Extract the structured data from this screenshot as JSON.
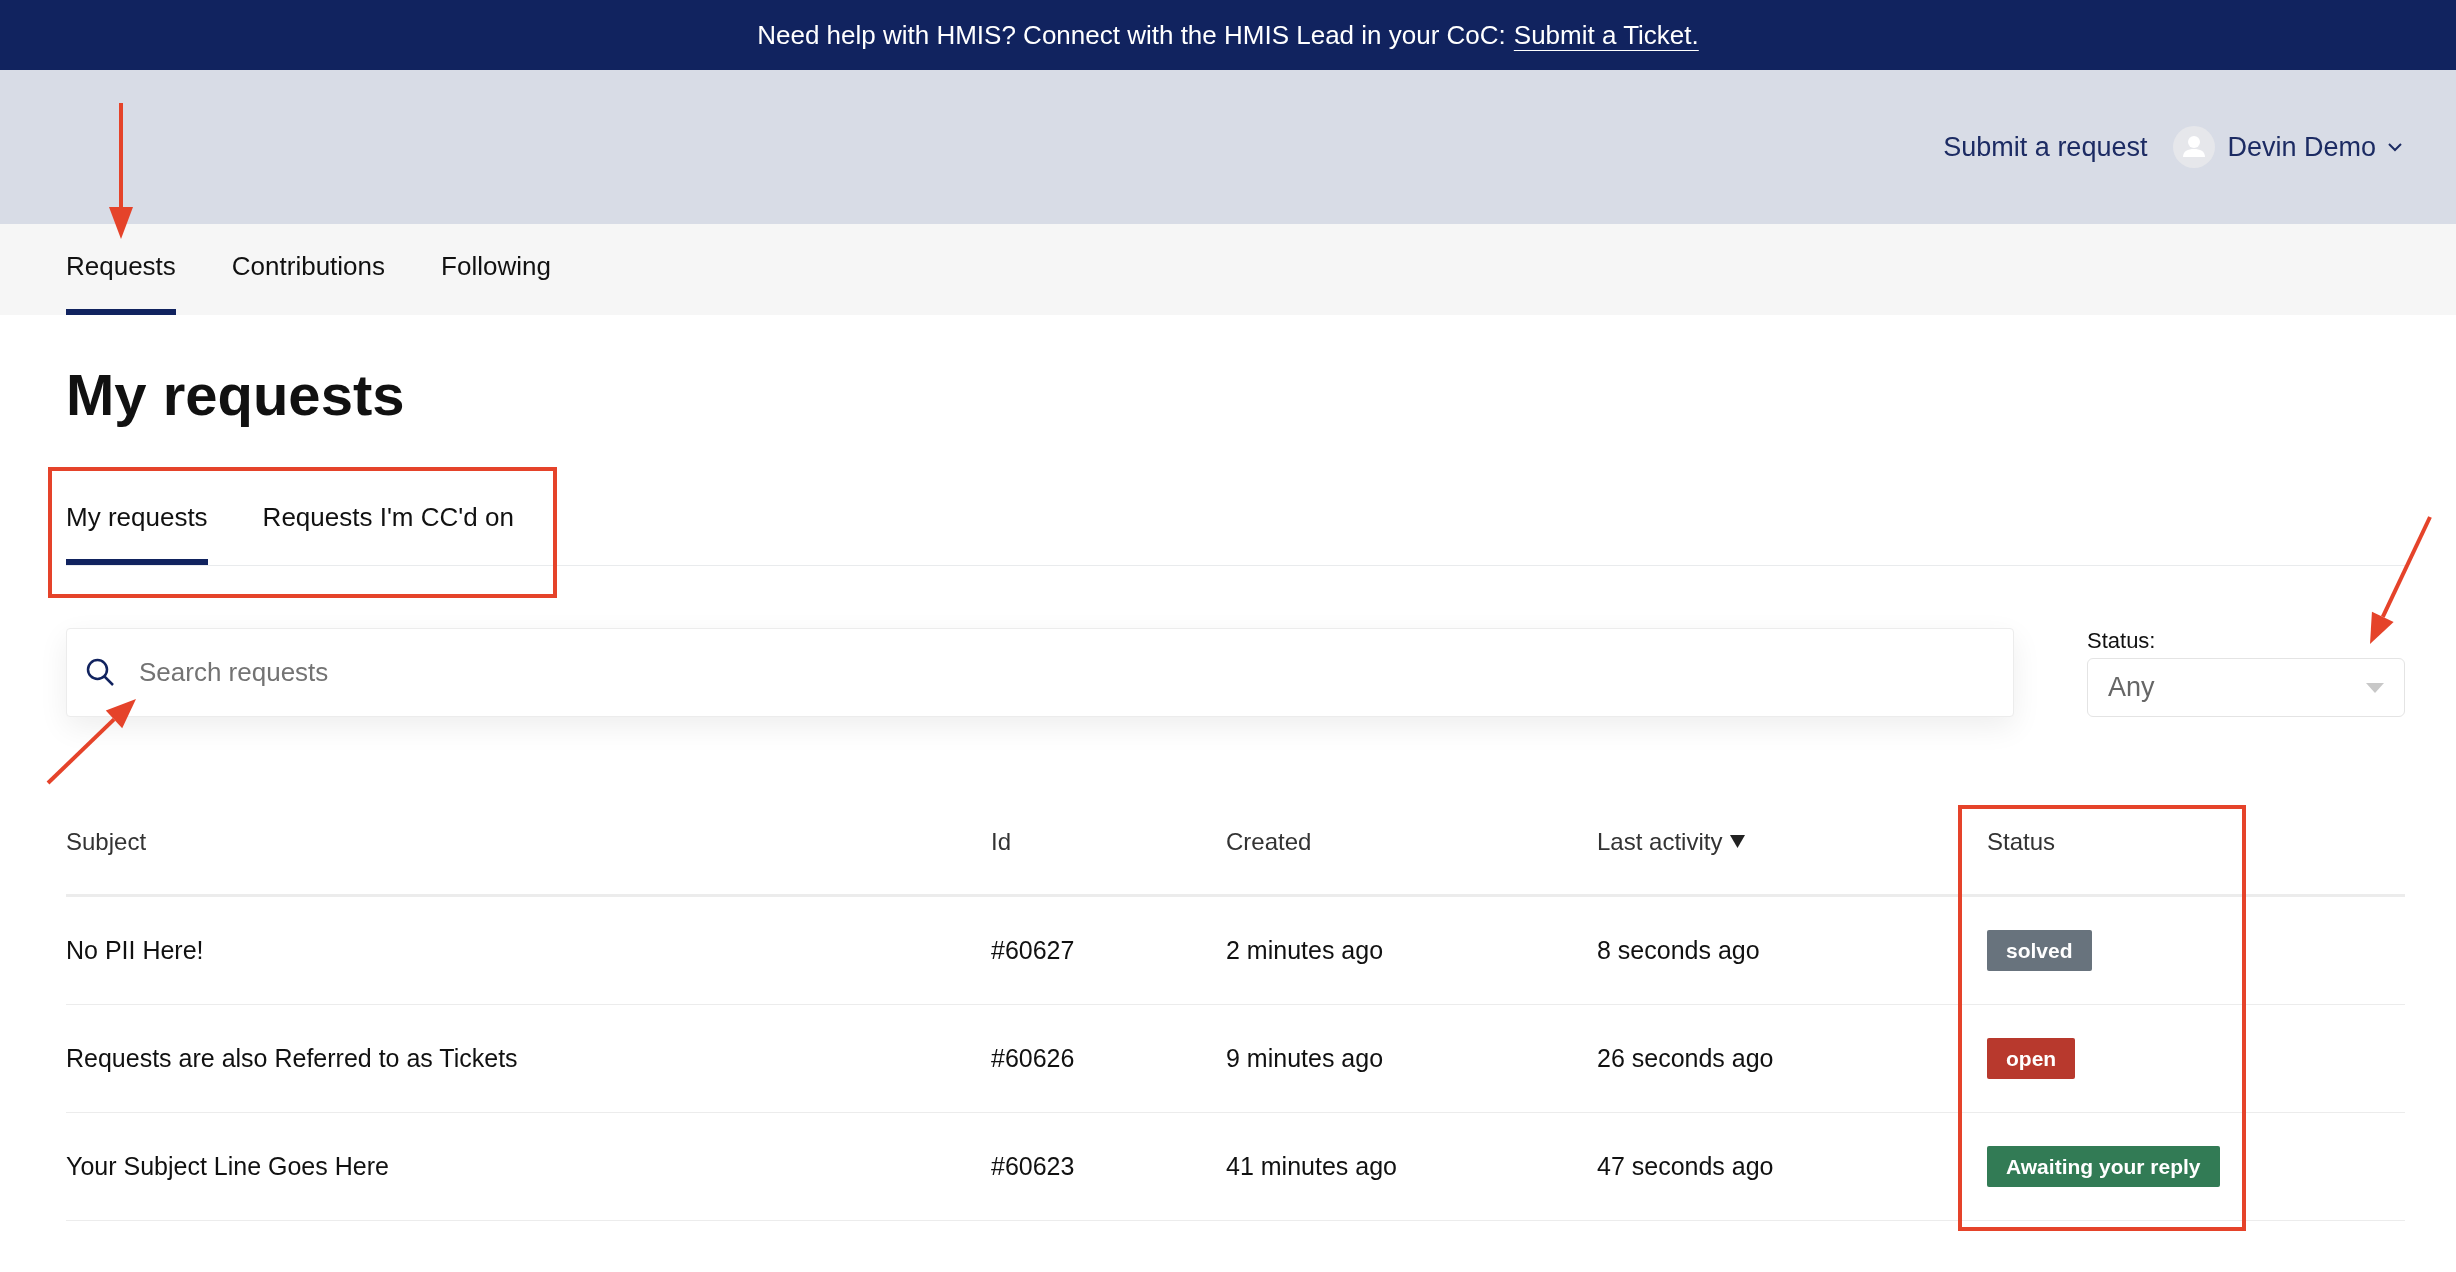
{
  "banner": {
    "text": "Need help with HMIS? Connect with the HMIS Lead in your CoC:",
    "link": "Submit a Ticket."
  },
  "header": {
    "submit_link": "Submit a request",
    "user": {
      "name": "Devin Demo"
    }
  },
  "nav_tabs": [
    {
      "label": "Requests",
      "selected": true,
      "arrow_callout": true
    },
    {
      "label": "Contributions",
      "selected": false,
      "arrow_callout": false
    },
    {
      "label": "Following",
      "selected": false,
      "arrow_callout": false
    }
  ],
  "page_title": "My requests",
  "sub_tabs": {
    "framed": true,
    "items": [
      {
        "label": "My requests",
        "selected": true
      },
      {
        "label": "Requests I'm CC'd on",
        "selected": false
      }
    ]
  },
  "search": {
    "placeholder": "Search requests",
    "arrow_callout": true
  },
  "status_filter": {
    "label": "Status:",
    "value": "Any",
    "arrow_callout": true
  },
  "table": {
    "columns": [
      {
        "label": "Subject",
        "sorted": false,
        "framed": false
      },
      {
        "label": "Id",
        "sorted": false,
        "framed": false
      },
      {
        "label": "Created",
        "sorted": false,
        "framed": false
      },
      {
        "label": "Last activity",
        "sorted": true,
        "framed": false
      },
      {
        "label": "Status",
        "sorted": false,
        "framed": true
      }
    ],
    "rows": [
      {
        "subject": "No PII Here!",
        "id": "#60627",
        "created": "2 minutes ago",
        "last_activity": "8 seconds ago",
        "status": {
          "label": "solved",
          "color": "#68737d"
        }
      },
      {
        "subject": "Requests are also Referred to as Tickets",
        "id": "#60626",
        "created": "9 minutes ago",
        "last_activity": "26 seconds ago",
        "status": {
          "label": "open",
          "color": "#b8392d"
        }
      },
      {
        "subject": "Your Subject Line Goes Here",
        "id": "#60623",
        "created": "41 minutes ago",
        "last_activity": "47 seconds ago",
        "status": {
          "label": "Awaiting your reply",
          "color": "#327b55"
        }
      }
    ]
  }
}
